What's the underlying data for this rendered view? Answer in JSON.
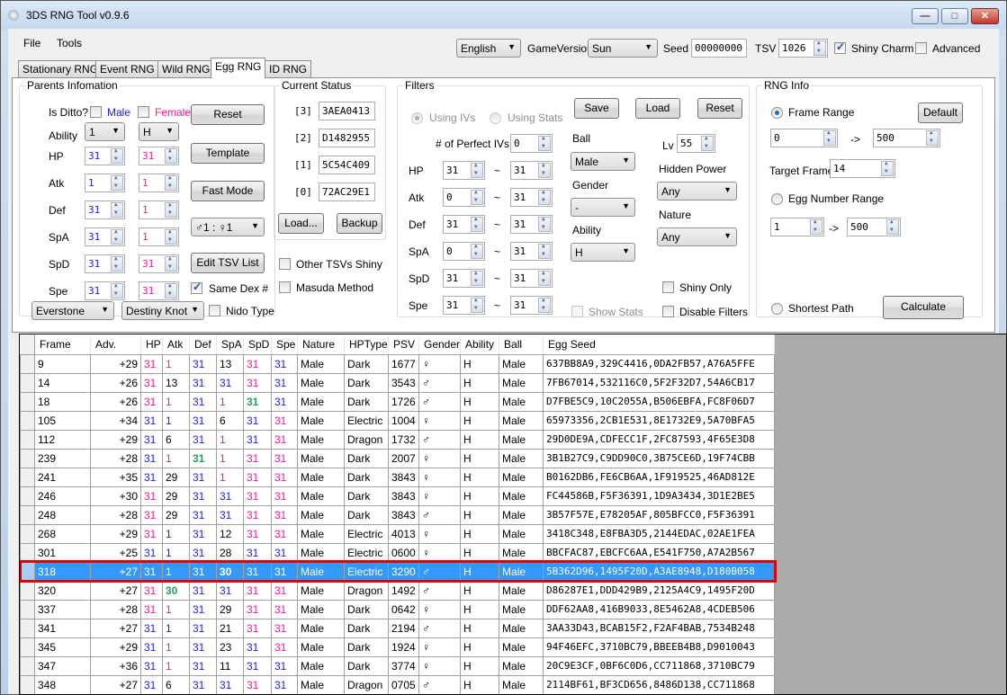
{
  "window": {
    "title": "3DS RNG Tool v0.9.6",
    "controls": {
      "minimize": "—",
      "maximize": "□",
      "close": "✕"
    }
  },
  "menu": [
    "File",
    "Tools"
  ],
  "toolbar": {
    "language": "English",
    "game_version_label": "GameVersion",
    "game_version": "Sun",
    "seed_label": "Seed",
    "seed": "00000000",
    "tsv_label": "TSV",
    "tsv": "1026",
    "shiny_charm_label": "Shiny Charm",
    "shiny_charm_checked": true,
    "advanced_label": "Advanced",
    "advanced_checked": false
  },
  "tabs": [
    {
      "label": "Stationary RNG",
      "active": false
    },
    {
      "label": "Event RNG",
      "active": false
    },
    {
      "label": "Wild RNG",
      "active": false
    },
    {
      "label": "Egg RNG",
      "active": true
    },
    {
      "label": "ID RNG",
      "active": false
    }
  ],
  "parents": {
    "legend": "Parents Infomation",
    "is_ditto_label": "Is Ditto?",
    "male_label": "Male",
    "female_label": "Female",
    "ability_label": "Ability",
    "male_ability": "1",
    "female_ability": "H",
    "stats": [
      {
        "label": "HP",
        "male": "31",
        "female": "31"
      },
      {
        "label": "Atk",
        "male": "1",
        "female": "1"
      },
      {
        "label": "Def",
        "male": "31",
        "female": "1"
      },
      {
        "label": "SpA",
        "male": "31",
        "female": "1"
      },
      {
        "label": "SpD",
        "male": "31",
        "female": "31"
      },
      {
        "label": "Spe",
        "male": "31",
        "female": "31"
      }
    ],
    "reset_button": "Reset",
    "template_button": "Template",
    "fast_mode_button": "Fast Mode",
    "gender_ratio": "♂1 : ♀1",
    "edit_tsv_button": "Edit TSV List",
    "same_dex_label": "Same Dex #",
    "same_dex_checked": true,
    "male_item": "Everstone",
    "female_item": "Destiny Knot",
    "nido_type_label": "Nido Type",
    "nido_type_checked": false
  },
  "current_status": {
    "legend": "Current Status",
    "seeds": [
      {
        "label": "[3]",
        "value": "3AEA0413"
      },
      {
        "label": "[2]",
        "value": "D1482955"
      },
      {
        "label": "[1]",
        "value": "5C54C409"
      },
      {
        "label": "[0]",
        "value": "72AC29E1"
      }
    ],
    "load_button": "Load...",
    "backup_button": "Backup",
    "other_tsvs_label": "Other TSVs Shiny",
    "masuda_label": "Masuda Method"
  },
  "filters": {
    "legend": "Filters",
    "using_ivs_label": "Using IVs",
    "using_stats_label": "Using Stats",
    "save_button": "Save",
    "load_button": "Load",
    "reset_button": "Reset",
    "perfect_ivs_label": "# of Perfect IVs",
    "perfect_ivs": "0",
    "tilde": "~",
    "ranges": [
      {
        "label": "HP",
        "min": "31",
        "max": "31"
      },
      {
        "label": "Atk",
        "min": "0",
        "max": "31"
      },
      {
        "label": "Def",
        "min": "31",
        "max": "31"
      },
      {
        "label": "SpA",
        "min": "0",
        "max": "31"
      },
      {
        "label": "SpD",
        "min": "31",
        "max": "31"
      },
      {
        "label": "Spe",
        "min": "31",
        "max": "31"
      }
    ],
    "ball_label": "Ball",
    "ball": "Male",
    "gender_label": "Gender",
    "gender": "-",
    "ability_label": "Ability",
    "ability": "H",
    "lv_label": "Lv",
    "lv": "55",
    "hidden_power_label": "Hidden Power",
    "hidden_power": "Any",
    "nature_label": "Nature",
    "nature": "Any",
    "show_stats_label": "Show Stats",
    "shiny_only_label": "Shiny Only",
    "disable_filters_label": "Disable Filters"
  },
  "rng_info": {
    "legend": "RNG Info",
    "frame_range_label": "Frame Range",
    "default_button": "Default",
    "frame_min": "0",
    "frame_max": "500",
    "arrow": "->",
    "target_frame_label": "Target Frame",
    "target_frame": "14",
    "egg_number_label": "Egg Number Range",
    "egg_min": "1",
    "egg_max": "500",
    "shortest_path_label": "Shortest Path",
    "calculate_button": "Calculate"
  },
  "results": {
    "columns": [
      "Frame",
      "Adv.",
      "HP",
      "Atk",
      "Def",
      "SpA",
      "SpD",
      "Spe",
      "Nature",
      "HPType",
      "PSV",
      "Gender",
      "Ability",
      "Ball",
      "Egg Seed"
    ],
    "iv_color_legend": {
      "b": "#1a1aff",
      "p": "#ff1493",
      "g": "#28a060",
      "k": "#000000"
    },
    "selected_index": 11,
    "rows": [
      {
        "frame": "9",
        "adv": "+29",
        "ivs": [
          "31",
          "1",
          "31",
          "13",
          "31",
          "31"
        ],
        "iv_src": [
          "p",
          "p",
          "b",
          "k",
          "p",
          "b"
        ],
        "nature": "Male",
        "hptype": "Dark",
        "psv": "1677",
        "gender": "♀",
        "ability": "H",
        "ball": "Male",
        "seed": "637BB8A9,329C4416,0DA2FB57,A76A5FFE"
      },
      {
        "frame": "14",
        "adv": "+26",
        "ivs": [
          "31",
          "13",
          "31",
          "31",
          "31",
          "31"
        ],
        "iv_src": [
          "p",
          "k",
          "b",
          "b",
          "p",
          "b"
        ],
        "nature": "Male",
        "hptype": "Dark",
        "psv": "3543",
        "gender": "♂",
        "ability": "H",
        "ball": "Male",
        "seed": "7FB67014,532116C0,5F2F32D7,54A6CB17"
      },
      {
        "frame": "18",
        "adv": "+26",
        "ivs": [
          "31",
          "1",
          "31",
          "1",
          "31",
          "31"
        ],
        "iv_src": [
          "p",
          "p",
          "b",
          "p",
          "g",
          "b"
        ],
        "nature": "Male",
        "hptype": "Dark",
        "psv": "1726",
        "gender": "♂",
        "ability": "H",
        "ball": "Male",
        "seed": "D7FBE5C9,10C2055A,B506EBFA,FC8F06D7"
      },
      {
        "frame": "105",
        "adv": "+34",
        "ivs": [
          "31",
          "1",
          "31",
          "6",
          "31",
          "31"
        ],
        "iv_src": [
          "b",
          "b",
          "b",
          "k",
          "b",
          "p"
        ],
        "nature": "Male",
        "hptype": "Electric",
        "psv": "1004",
        "gender": "♀",
        "ability": "H",
        "ball": "Male",
        "seed": "65973356,2CB1E531,8E1732E9,5A70BFA5"
      },
      {
        "frame": "112",
        "adv": "+29",
        "ivs": [
          "31",
          "6",
          "31",
          "1",
          "31",
          "31"
        ],
        "iv_src": [
          "b",
          "k",
          "b",
          "p",
          "b",
          "p"
        ],
        "nature": "Male",
        "hptype": "Dragon",
        "psv": "1732",
        "gender": "♂",
        "ability": "H",
        "ball": "Male",
        "seed": "29D0DE9A,CDFECC1F,2FC87593,4F65E3D8"
      },
      {
        "frame": "239",
        "adv": "+28",
        "ivs": [
          "31",
          "1",
          "31",
          "1",
          "31",
          "31"
        ],
        "iv_src": [
          "b",
          "p",
          "g",
          "p",
          "p",
          "p"
        ],
        "nature": "Male",
        "hptype": "Dark",
        "psv": "2007",
        "gender": "♀",
        "ability": "H",
        "ball": "Male",
        "seed": "3B1B27C9,C9DD90C0,3B75CE6D,19F74CBB"
      },
      {
        "frame": "241",
        "adv": "+35",
        "ivs": [
          "31",
          "29",
          "31",
          "1",
          "31",
          "31"
        ],
        "iv_src": [
          "b",
          "k",
          "b",
          "p",
          "p",
          "p"
        ],
        "nature": "Male",
        "hptype": "Dark",
        "psv": "3843",
        "gender": "♀",
        "ability": "H",
        "ball": "Male",
        "seed": "B0162DB6,FE6CB6AA,1F919525,46AD812E"
      },
      {
        "frame": "246",
        "adv": "+30",
        "ivs": [
          "31",
          "29",
          "31",
          "31",
          "31",
          "31"
        ],
        "iv_src": [
          "p",
          "k",
          "b",
          "b",
          "p",
          "p"
        ],
        "nature": "Male",
        "hptype": "Dark",
        "psv": "3843",
        "gender": "♀",
        "ability": "H",
        "ball": "Male",
        "seed": "FC44586B,F5F36391,1D9A3434,3D1E2BE5"
      },
      {
        "frame": "248",
        "adv": "+28",
        "ivs": [
          "31",
          "29",
          "31",
          "31",
          "31",
          "31"
        ],
        "iv_src": [
          "p",
          "k",
          "b",
          "b",
          "p",
          "p"
        ],
        "nature": "Male",
        "hptype": "Dark",
        "psv": "3843",
        "gender": "♂",
        "ability": "H",
        "ball": "Male",
        "seed": "3B57F57E,E78205AF,805BFCC0,F5F36391"
      },
      {
        "frame": "268",
        "adv": "+29",
        "ivs": [
          "31",
          "1",
          "31",
          "12",
          "31",
          "31"
        ],
        "iv_src": [
          "p",
          "b",
          "b",
          "k",
          "p",
          "p"
        ],
        "nature": "Male",
        "hptype": "Electric",
        "psv": "4013",
        "gender": "♀",
        "ability": "H",
        "ball": "Male",
        "seed": "3418C348,E8FBA3D5,2144EDAC,02AE1FEA"
      },
      {
        "frame": "301",
        "adv": "+25",
        "ivs": [
          "31",
          "1",
          "31",
          "28",
          "31",
          "31"
        ],
        "iv_src": [
          "b",
          "b",
          "b",
          "k",
          "b",
          "b"
        ],
        "nature": "Male",
        "hptype": "Electric",
        "psv": "0600",
        "gender": "♀",
        "ability": "H",
        "ball": "Male",
        "seed": "BBCFAC87,EBCFC6AA,E541F750,A7A2B567"
      },
      {
        "frame": "318",
        "adv": "+27",
        "ivs": [
          "31",
          "1",
          "31",
          "30",
          "31",
          "31"
        ],
        "iv_src": [
          "b",
          "b",
          "b",
          "g",
          "b",
          "b"
        ],
        "nature": "Male",
        "hptype": "Electric",
        "psv": "3290",
        "gender": "♂",
        "ability": "H",
        "ball": "Male",
        "seed": "5B362D96,1495F20D,A3AE8948,D180B058"
      },
      {
        "frame": "320",
        "adv": "+27",
        "ivs": [
          "31",
          "30",
          "31",
          "31",
          "31",
          "31"
        ],
        "iv_src": [
          "p",
          "g",
          "b",
          "b",
          "p",
          "p"
        ],
        "nature": "Male",
        "hptype": "Dragon",
        "psv": "1492",
        "gender": "♂",
        "ability": "H",
        "ball": "Male",
        "seed": "D86287E1,DDD429B9,2125A4C9,1495F20D"
      },
      {
        "frame": "337",
        "adv": "+28",
        "ivs": [
          "31",
          "1",
          "31",
          "29",
          "31",
          "31"
        ],
        "iv_src": [
          "p",
          "p",
          "b",
          "k",
          "p",
          "p"
        ],
        "nature": "Male",
        "hptype": "Dark",
        "psv": "0642",
        "gender": "♀",
        "ability": "H",
        "ball": "Male",
        "seed": "DDF62AA8,416B9033,8E5462A8,4CDEB506"
      },
      {
        "frame": "341",
        "adv": "+27",
        "ivs": [
          "31",
          "1",
          "31",
          "21",
          "31",
          "31"
        ],
        "iv_src": [
          "b",
          "b",
          "b",
          "k",
          "p",
          "p"
        ],
        "nature": "Male",
        "hptype": "Dark",
        "psv": "2194",
        "gender": "♂",
        "ability": "H",
        "ball": "Male",
        "seed": "3AA33D43,BCAB15F2,F2AF4BAB,7534B248"
      },
      {
        "frame": "345",
        "adv": "+29",
        "ivs": [
          "31",
          "1",
          "31",
          "23",
          "31",
          "31"
        ],
        "iv_src": [
          "b",
          "p",
          "b",
          "k",
          "b",
          "p"
        ],
        "nature": "Male",
        "hptype": "Dark",
        "psv": "1924",
        "gender": "♀",
        "ability": "H",
        "ball": "Male",
        "seed": "94F46EFC,3710BC79,BBEEB4B8,D9010043"
      },
      {
        "frame": "347",
        "adv": "+36",
        "ivs": [
          "31",
          "1",
          "31",
          "11",
          "31",
          "31"
        ],
        "iv_src": [
          "b",
          "p",
          "b",
          "k",
          "b",
          "b"
        ],
        "nature": "Male",
        "hptype": "Dark",
        "psv": "3774",
        "gender": "♀",
        "ability": "H",
        "ball": "Male",
        "seed": "20C9E3CF,0BF6C0D6,CC711868,3710BC79"
      },
      {
        "frame": "348",
        "adv": "+27",
        "ivs": [
          "31",
          "6",
          "31",
          "31",
          "31",
          "31"
        ],
        "iv_src": [
          "b",
          "k",
          "b",
          "b",
          "p",
          "b"
        ],
        "nature": "Male",
        "hptype": "Dragon",
        "psv": "0705",
        "gender": "♂",
        "ability": "H",
        "ball": "Male",
        "seed": "2114BF61,BF3CD656,8486D138,CC711868"
      }
    ]
  }
}
